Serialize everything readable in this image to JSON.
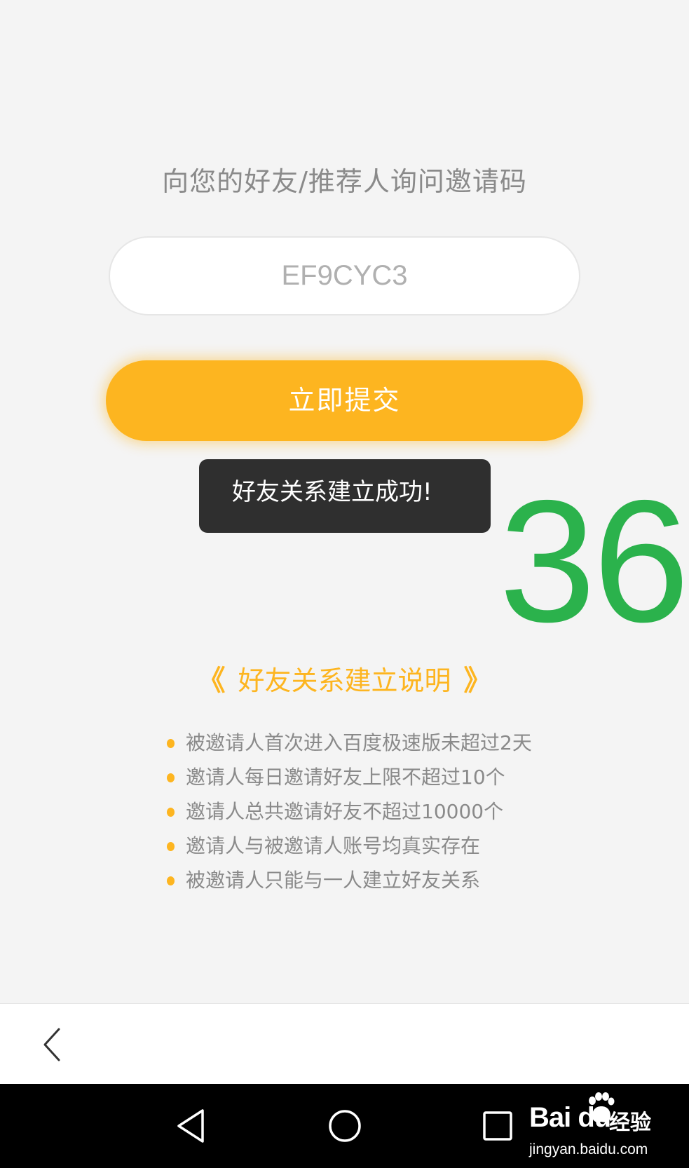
{
  "invite": {
    "prompt": "向您的好友/推荐人询问邀请码",
    "code_value": "EF9CYC3",
    "submit_label": "立即提交"
  },
  "toast": {
    "message": "好友关系建立成功!"
  },
  "overlay_step": "36",
  "rules": {
    "left_chevron": "《",
    "title": "好友关系建立说明",
    "right_chevron": "》",
    "items": [
      "被邀请人首次进入百度极速版未超过2天",
      "邀请人每日邀请好友上限不超过10个",
      "邀请人总共邀请好友不超过10000个",
      "邀请人与被邀请人账号均真实存在",
      "被邀请人只能与一人建立好友关系"
    ]
  },
  "nav": {
    "back_icon": "chevron-left-icon"
  },
  "system_nav": {
    "back_icon": "triangle-back-icon",
    "home_icon": "circle-home-icon",
    "recents_icon": "square-recents-icon"
  },
  "watermark": {
    "brand": "Bai du",
    "product": "经验",
    "url": "jingyan.baidu.com"
  },
  "colors": {
    "accent": "#fdb520",
    "overlay_green": "#2bb24c",
    "toast_bg": "#2f2f2f",
    "page_bg": "#f4f4f4"
  }
}
